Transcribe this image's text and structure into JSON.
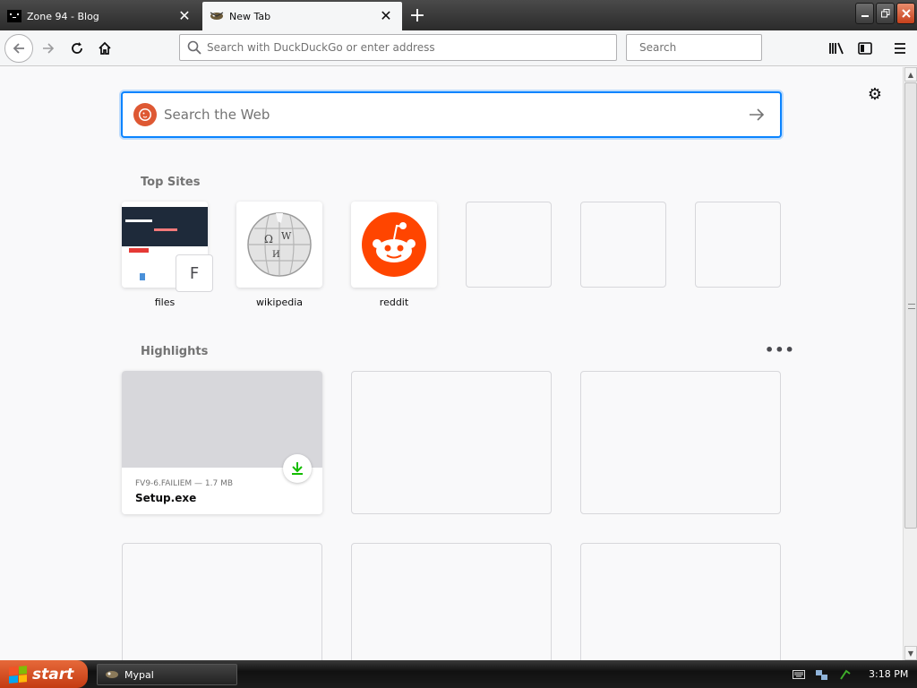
{
  "tabs": [
    {
      "title": "Zone 94 - Blog",
      "active": false
    },
    {
      "title": "New Tab",
      "active": true
    }
  ],
  "navbar": {
    "url_placeholder": "Search with DuckDuckGo or enter address",
    "search_placeholder": "Search"
  },
  "newtab": {
    "search_placeholder": "Search the Web",
    "top_sites_heading": "Top Sites",
    "top_sites": [
      {
        "label": "files",
        "badge": "F"
      },
      {
        "label": "wikipedia"
      },
      {
        "label": "reddit"
      },
      {
        "label": ""
      },
      {
        "label": ""
      },
      {
        "label": ""
      }
    ],
    "highlights_heading": "Highlights",
    "highlights_menu": "•••",
    "highlight": {
      "meta": "FV9-6.FAILIEM — 1.7 MB",
      "title": "Setup.exe"
    }
  },
  "taskbar": {
    "start_label": "start",
    "task_label": "Mypal",
    "clock": "3:18 PM"
  },
  "colors": {
    "accent": "#0a84ff",
    "reddit": "#ff4500",
    "download_green": "#12bc00",
    "ddg": "#de5833"
  }
}
